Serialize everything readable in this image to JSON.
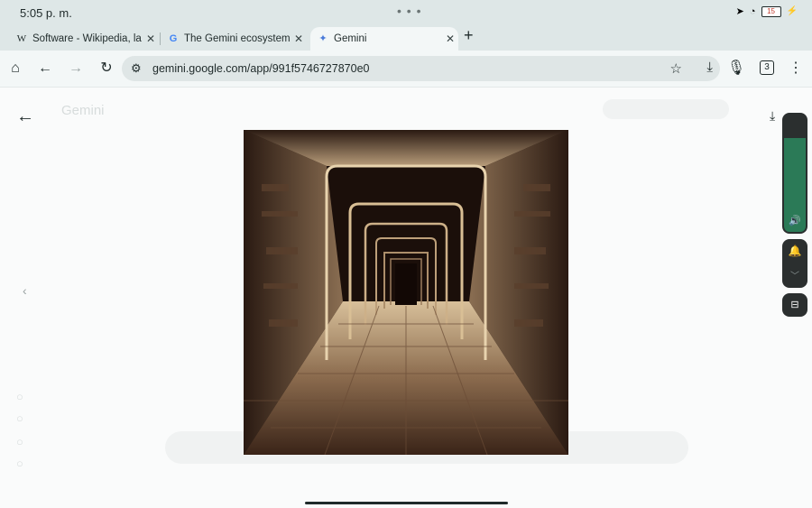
{
  "status_bar": {
    "time": "5:05 p. m.",
    "battery_level": "15"
  },
  "tabs": [
    {
      "title": "Software - Wikipedia, la enciclopedia libre",
      "favicon": "W"
    },
    {
      "title": "The Gemini ecosystem - Google",
      "favicon": "G"
    },
    {
      "title": "Gemini",
      "favicon": "✦"
    }
  ],
  "toolbar": {
    "url": "gemini.google.com/app/991f5746727870e0",
    "tab_count": "3"
  },
  "gemini_background": {
    "app_name": "Gemini"
  },
  "image_viewer": {
    "image_alt": "Pixel art of a long stone corridor with glowing arches"
  },
  "colors": {
    "accent": "#2b7a57",
    "chrome_bg": "#dee7e7",
    "image_bg": "#1b0f0a"
  },
  "icons": [
    "home-icon",
    "back-icon",
    "forward-icon",
    "reload-icon",
    "tune-icon",
    "star-icon",
    "download-icon",
    "mic-icon",
    "tab-switcher-icon",
    "menu-icon",
    "volume-icon",
    "bell-icon",
    "captions-icon"
  ]
}
